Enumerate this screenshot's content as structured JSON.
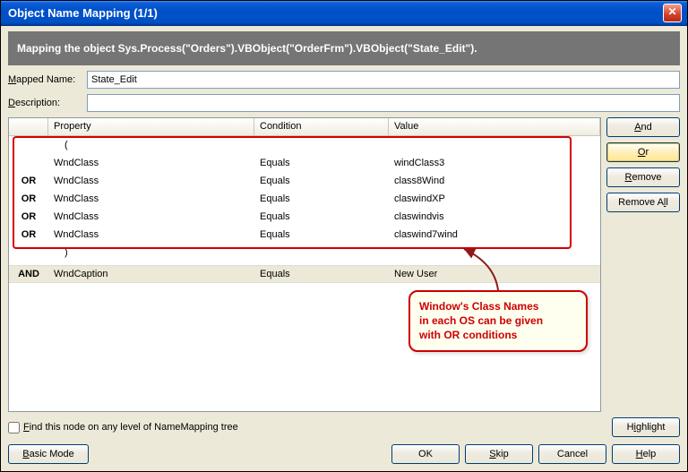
{
  "title": "Object Name Mapping (1/1)",
  "banner": "Mapping the object Sys.Process(\"Orders\").VBObject(\"OrderFrm\").VBObject(\"State_Edit\").",
  "labels": {
    "mapped_name": "Mapped Name:",
    "description": "Description:",
    "property": "Property",
    "condition": "Condition",
    "value": "Value"
  },
  "fields": {
    "mapped_name_value": "State_Edit",
    "description_value": ""
  },
  "side_buttons": {
    "and": "And",
    "or": "Or",
    "remove": "Remove",
    "remove_all": "Remove All"
  },
  "grid": {
    "open_paren": "(",
    "close_paren": ")",
    "rows": [
      {
        "op": "",
        "prop": "WndClass",
        "cond": "Equals",
        "val": "windClass3"
      },
      {
        "op": "OR",
        "prop": "WndClass",
        "cond": "Equals",
        "val": "class8Wind"
      },
      {
        "op": "OR",
        "prop": "WndClass",
        "cond": "Equals",
        "val": "claswindXP"
      },
      {
        "op": "OR",
        "prop": "WndClass",
        "cond": "Equals",
        "val": "claswindvis"
      },
      {
        "op": "OR",
        "prop": "WndClass",
        "cond": "Equals",
        "val": "claswind7wind"
      }
    ],
    "and_row": {
      "op": "AND",
      "prop": "WndCaption",
      "cond": "Equals",
      "val": "New User"
    }
  },
  "checkbox_label": "Find this node on any level of NameMapping tree",
  "buttons": {
    "highlight": "Highlight",
    "basic_mode": "Basic Mode",
    "ok": "OK",
    "skip": "Skip",
    "cancel": "Cancel",
    "help": "Help"
  },
  "callout": {
    "line1": "Window's Class Names",
    "line2": "in each OS can be given",
    "line3": "with OR conditions"
  }
}
